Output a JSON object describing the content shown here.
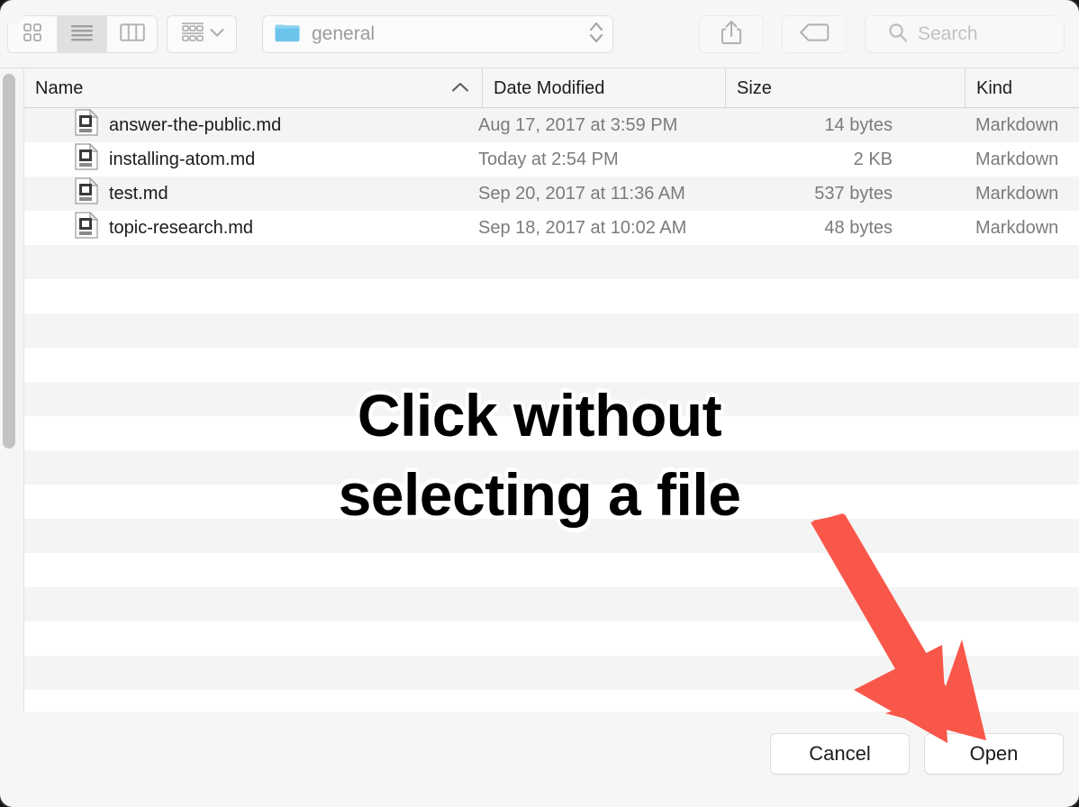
{
  "window": {
    "accent_red": "#F9574A",
    "folder_blue": "#6CC4EC"
  },
  "toolbar": {
    "view_modes": [
      {
        "name": "icon-view",
        "icon": "grid-icon",
        "active": false
      },
      {
        "name": "list-view",
        "icon": "list-icon",
        "active": true
      },
      {
        "name": "column-view",
        "icon": "columns-icon",
        "active": false
      }
    ],
    "arrange": {
      "label": "",
      "icon": "arrange-icon",
      "chevron": "chevron-down-icon"
    },
    "path": {
      "label": "general",
      "icon": "folder-icon",
      "stepper": "up-down-stepper-icon"
    },
    "share": {
      "icon": "share-icon"
    },
    "tags": {
      "icon": "tag-icon"
    },
    "search": {
      "placeholder": "Search",
      "icon": "search-icon"
    }
  },
  "file_list": {
    "columns": [
      {
        "key": "name",
        "label": "Name",
        "sorted": true,
        "sort_direction": "ascending"
      },
      {
        "key": "date",
        "label": "Date Modified"
      },
      {
        "key": "size",
        "label": "Size"
      },
      {
        "key": "kind",
        "label": "Kind"
      }
    ],
    "rows": [
      {
        "name": "answer-the-public.md",
        "date": "Aug 17, 2017 at 3:59 PM",
        "size": "14 bytes",
        "kind": "Markdown",
        "icon": "markdown-file-icon"
      },
      {
        "name": "installing-atom.md",
        "date": "Today at 2:54 PM",
        "size": "2 KB",
        "kind": "Markdown",
        "icon": "markdown-file-icon"
      },
      {
        "name": "test.md",
        "date": "Sep 20, 2017 at 11:36 AM",
        "size": "537 bytes",
        "kind": "Markdown",
        "icon": "markdown-file-icon"
      },
      {
        "name": "topic-research.md",
        "date": "Sep 18, 2017 at 10:02 AM",
        "size": "48 bytes",
        "kind": "Markdown",
        "icon": "markdown-file-icon"
      }
    ],
    "empty_row_count": 14
  },
  "footer": {
    "cancel_label": "Cancel",
    "open_label": "Open"
  },
  "annotation": {
    "line1": "Click without",
    "line2": "selecting a file",
    "arrow": "down-right-arrow-icon",
    "arrow_color": "#F9574A"
  }
}
